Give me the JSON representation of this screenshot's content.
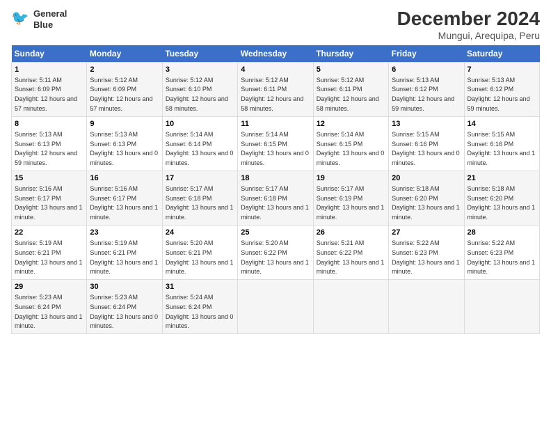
{
  "title": "December 2024",
  "subtitle": "Mungui, Arequipa, Peru",
  "logo": {
    "line1": "General",
    "line2": "Blue"
  },
  "days_of_week": [
    "Sunday",
    "Monday",
    "Tuesday",
    "Wednesday",
    "Thursday",
    "Friday",
    "Saturday"
  ],
  "weeks": [
    [
      {
        "day": 1,
        "sunrise": "5:11 AM",
        "sunset": "6:09 PM",
        "daylight": "12 hours and 57 minutes."
      },
      {
        "day": 2,
        "sunrise": "5:12 AM",
        "sunset": "6:09 PM",
        "daylight": "12 hours and 57 minutes."
      },
      {
        "day": 3,
        "sunrise": "5:12 AM",
        "sunset": "6:10 PM",
        "daylight": "12 hours and 58 minutes."
      },
      {
        "day": 4,
        "sunrise": "5:12 AM",
        "sunset": "6:11 PM",
        "daylight": "12 hours and 58 minutes."
      },
      {
        "day": 5,
        "sunrise": "5:12 AM",
        "sunset": "6:11 PM",
        "daylight": "12 hours and 58 minutes."
      },
      {
        "day": 6,
        "sunrise": "5:13 AM",
        "sunset": "6:12 PM",
        "daylight": "12 hours and 59 minutes."
      },
      {
        "day": 7,
        "sunrise": "5:13 AM",
        "sunset": "6:12 PM",
        "daylight": "12 hours and 59 minutes."
      }
    ],
    [
      {
        "day": 8,
        "sunrise": "5:13 AM",
        "sunset": "6:13 PM",
        "daylight": "12 hours and 59 minutes."
      },
      {
        "day": 9,
        "sunrise": "5:13 AM",
        "sunset": "6:13 PM",
        "daylight": "13 hours and 0 minutes."
      },
      {
        "day": 10,
        "sunrise": "5:14 AM",
        "sunset": "6:14 PM",
        "daylight": "13 hours and 0 minutes."
      },
      {
        "day": 11,
        "sunrise": "5:14 AM",
        "sunset": "6:15 PM",
        "daylight": "13 hours and 0 minutes."
      },
      {
        "day": 12,
        "sunrise": "5:14 AM",
        "sunset": "6:15 PM",
        "daylight": "13 hours and 0 minutes."
      },
      {
        "day": 13,
        "sunrise": "5:15 AM",
        "sunset": "6:16 PM",
        "daylight": "13 hours and 0 minutes."
      },
      {
        "day": 14,
        "sunrise": "5:15 AM",
        "sunset": "6:16 PM",
        "daylight": "13 hours and 1 minute."
      }
    ],
    [
      {
        "day": 15,
        "sunrise": "5:16 AM",
        "sunset": "6:17 PM",
        "daylight": "13 hours and 1 minute."
      },
      {
        "day": 16,
        "sunrise": "5:16 AM",
        "sunset": "6:17 PM",
        "daylight": "13 hours and 1 minute."
      },
      {
        "day": 17,
        "sunrise": "5:17 AM",
        "sunset": "6:18 PM",
        "daylight": "13 hours and 1 minute."
      },
      {
        "day": 18,
        "sunrise": "5:17 AM",
        "sunset": "6:18 PM",
        "daylight": "13 hours and 1 minute."
      },
      {
        "day": 19,
        "sunrise": "5:17 AM",
        "sunset": "6:19 PM",
        "daylight": "13 hours and 1 minute."
      },
      {
        "day": 20,
        "sunrise": "5:18 AM",
        "sunset": "6:20 PM",
        "daylight": "13 hours and 1 minute."
      },
      {
        "day": 21,
        "sunrise": "5:18 AM",
        "sunset": "6:20 PM",
        "daylight": "13 hours and 1 minute."
      }
    ],
    [
      {
        "day": 22,
        "sunrise": "5:19 AM",
        "sunset": "6:21 PM",
        "daylight": "13 hours and 1 minute."
      },
      {
        "day": 23,
        "sunrise": "5:19 AM",
        "sunset": "6:21 PM",
        "daylight": "13 hours and 1 minute."
      },
      {
        "day": 24,
        "sunrise": "5:20 AM",
        "sunset": "6:21 PM",
        "daylight": "13 hours and 1 minute."
      },
      {
        "day": 25,
        "sunrise": "5:20 AM",
        "sunset": "6:22 PM",
        "daylight": "13 hours and 1 minute."
      },
      {
        "day": 26,
        "sunrise": "5:21 AM",
        "sunset": "6:22 PM",
        "daylight": "13 hours and 1 minute."
      },
      {
        "day": 27,
        "sunrise": "5:22 AM",
        "sunset": "6:23 PM",
        "daylight": "13 hours and 1 minute."
      },
      {
        "day": 28,
        "sunrise": "5:22 AM",
        "sunset": "6:23 PM",
        "daylight": "13 hours and 1 minute."
      }
    ],
    [
      {
        "day": 29,
        "sunrise": "5:23 AM",
        "sunset": "6:24 PM",
        "daylight": "13 hours and 1 minute."
      },
      {
        "day": 30,
        "sunrise": "5:23 AM",
        "sunset": "6:24 PM",
        "daylight": "13 hours and 0 minutes."
      },
      {
        "day": 31,
        "sunrise": "5:24 AM",
        "sunset": "6:24 PM",
        "daylight": "13 hours and 0 minutes."
      },
      null,
      null,
      null,
      null
    ]
  ]
}
